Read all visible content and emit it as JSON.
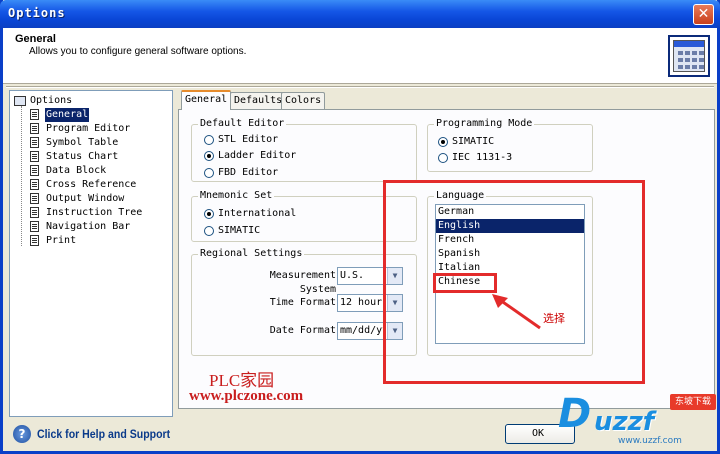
{
  "window": {
    "title": "Options",
    "close_label": "✕"
  },
  "header": {
    "title": "General",
    "description": "Allows you to configure general software options."
  },
  "tree": {
    "root": "Options",
    "items": [
      {
        "label": "General",
        "selected": true
      },
      {
        "label": "Program Editor"
      },
      {
        "label": "Symbol Table"
      },
      {
        "label": "Status Chart"
      },
      {
        "label": "Data Block"
      },
      {
        "label": "Cross Reference"
      },
      {
        "label": "Output Window"
      },
      {
        "label": "Instruction Tree"
      },
      {
        "label": "Navigation Bar"
      },
      {
        "label": "Print"
      }
    ]
  },
  "tabs": [
    {
      "label": "General",
      "active": true
    },
    {
      "label": "Defaults"
    },
    {
      "label": "Colors"
    }
  ],
  "default_editor": {
    "legend": "Default Editor",
    "options": [
      "STL Editor",
      "Ladder Editor",
      "FBD Editor"
    ],
    "selected": "Ladder Editor"
  },
  "mnemonic_set": {
    "legend": "Mnemonic Set",
    "options": [
      "International",
      "SIMATIC"
    ],
    "selected": "International"
  },
  "regional": {
    "legend": "Regional Settings",
    "measurement_label": "Measurement System",
    "measurement_value": "U.S.",
    "time_label": "Time Format",
    "time_value": "12 hour",
    "date_label": "Date Format",
    "date_value": "mm/dd/yy"
  },
  "programming_mode": {
    "legend": "Programming Mode",
    "options": [
      "SIMATIC",
      "IEC 1131-3"
    ],
    "selected": "SIMATIC"
  },
  "language": {
    "legend": "Language",
    "items": [
      "German",
      "English",
      "French",
      "Spanish",
      "Italian",
      "Chinese"
    ],
    "selected": "English",
    "highlighted": "Chinese"
  },
  "annotation": {
    "note": "选择",
    "accent_color": "#e32b2b"
  },
  "watermark": {
    "line1": "PLC家园",
    "line2": "www.plczone.com"
  },
  "footer": {
    "help_icon": "?",
    "help_text": "Click for Help and Support",
    "ok_label": "OK"
  },
  "site_logo": {
    "mark": "D",
    "word": "uzzf",
    "suffix": ".com",
    "ribbon": "东坡下载",
    "sub": "www.uzzf.com"
  },
  "icons": {
    "tree_root": "options-tree-icon",
    "tree_item": "document-icon",
    "header": "settings-window-icon",
    "help": "help-icon",
    "close": "close-icon"
  }
}
